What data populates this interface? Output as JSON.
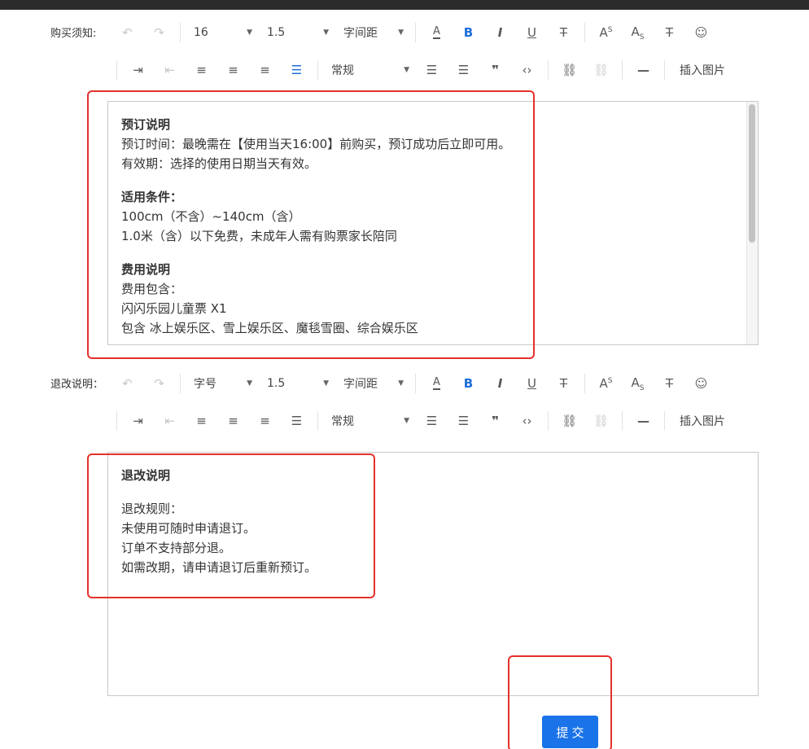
{
  "window": {
    "topbar_color": "#2b2b2b"
  },
  "editor1": {
    "label": "购买须知:",
    "font_size": "16",
    "line_height": "1.5",
    "letter_spacing": "字间距",
    "paragraph_style": "常规",
    "insert_image": "插入图片",
    "lines": [
      {
        "bold": true,
        "text": "预订说明"
      },
      {
        "text": "预订时间：最晚需在【使用当天16:00】前购买，预订成功后立即可用。"
      },
      {
        "text": "有效期：选择的使用日期当天有效。"
      },
      {
        "gap": true
      },
      {
        "bold": true,
        "text": "适用条件："
      },
      {
        "text": "100cm（不含）~140cm（含）"
      },
      {
        "text": "1.0米（含）以下免费，未成年人需有购票家长陪同"
      },
      {
        "gap": true
      },
      {
        "bold": true,
        "text": "费用说明"
      },
      {
        "text": "费用包含："
      },
      {
        "text": "闪闪乐园儿童票 X1"
      },
      {
        "text": "包含 冰上娱乐区、雪上娱乐区、魔毯雪圈、综合娱乐区"
      }
    ]
  },
  "editor2": {
    "label": "退改说明：",
    "font_size": "字号",
    "line_height": "1.5",
    "letter_spacing": "字间距",
    "paragraph_style": "常规",
    "insert_image": "插入图片",
    "lines": [
      {
        "bold": true,
        "text": "退改说明"
      },
      {
        "gap": true
      },
      {
        "text": "退改规则："
      },
      {
        "text": "未使用可随时申请退订。"
      },
      {
        "text": "订单不支持部分退。"
      },
      {
        "text": "如需改期，请申请退订后重新预订。"
      }
    ]
  },
  "toolbar_glyphs": {
    "undo": "↶",
    "redo": "↷",
    "font_color": "A",
    "bold": "B",
    "italic": "I",
    "underline": "U",
    "strike": "T",
    "superscript": "A",
    "subscript": "A",
    "clear_format": "T",
    "emoji": "☺",
    "indent": "⇥",
    "outdent": "⇤",
    "quote": "❞",
    "code": "‹›",
    "link": "⛓",
    "unlink": "⛓",
    "hr": "—",
    "sup_mark": "S",
    "sub_mark": "S",
    "x_mark": "×"
  },
  "submit": {
    "label": "提交",
    "color": "#1a73e8"
  },
  "highlight_color": "#e4312b"
}
